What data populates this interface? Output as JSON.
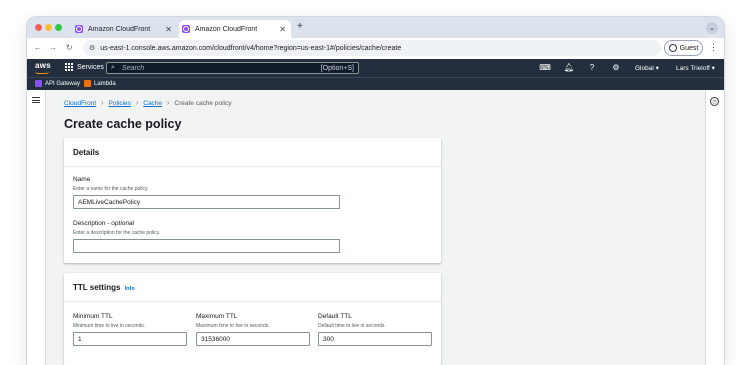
{
  "browser": {
    "tabs": [
      {
        "title": "Amazon CloudFront",
        "active": false
      },
      {
        "title": "Amazon CloudFront",
        "active": true
      }
    ],
    "new_tab": "+",
    "url": "us-east-1.console.aws.amazon.com/cloudfront/v4/home?region=us-east-1#/policies/cache/create",
    "guest_label": "Guest"
  },
  "aws_header": {
    "logo": "aws",
    "services_label": "Services",
    "search_placeholder": "Search",
    "search_shortcut": "[Option+S]",
    "region": "Global ▾",
    "user": "Lars Trieloff ▾",
    "favorites": [
      {
        "label": "API Gateway",
        "color": "#8c4fff"
      },
      {
        "label": "Lambda",
        "color": "#ed7100"
      }
    ]
  },
  "breadcrumb": {
    "items": [
      "CloudFront",
      "Policies",
      "Cache"
    ],
    "current": "Create cache policy"
  },
  "page_title": "Create cache policy",
  "details": {
    "heading": "Details",
    "name_label": "Name",
    "name_desc": "Enter a name for the cache policy.",
    "name_value": "AEMLiveCachePolicy",
    "desc_label": "Description",
    "desc_optional": " - optional",
    "desc_desc": "Enter a description for the cache policy.",
    "desc_value": ""
  },
  "ttl": {
    "heading": "TTL settings",
    "info": "Info",
    "min_label": "Minimum TTL",
    "min_desc": "Minimum time to live in seconds.",
    "min_value": "1",
    "max_label": "Maximum TTL",
    "max_desc": "Maximum time to live in seconds.",
    "max_value": "31536000",
    "default_label": "Default TTL",
    "default_desc": "Default time to live in seconds.",
    "default_value": "300"
  },
  "colors": {
    "aws_nav": "#232f3e",
    "link": "#0972d3",
    "accent": "#ff9900"
  }
}
